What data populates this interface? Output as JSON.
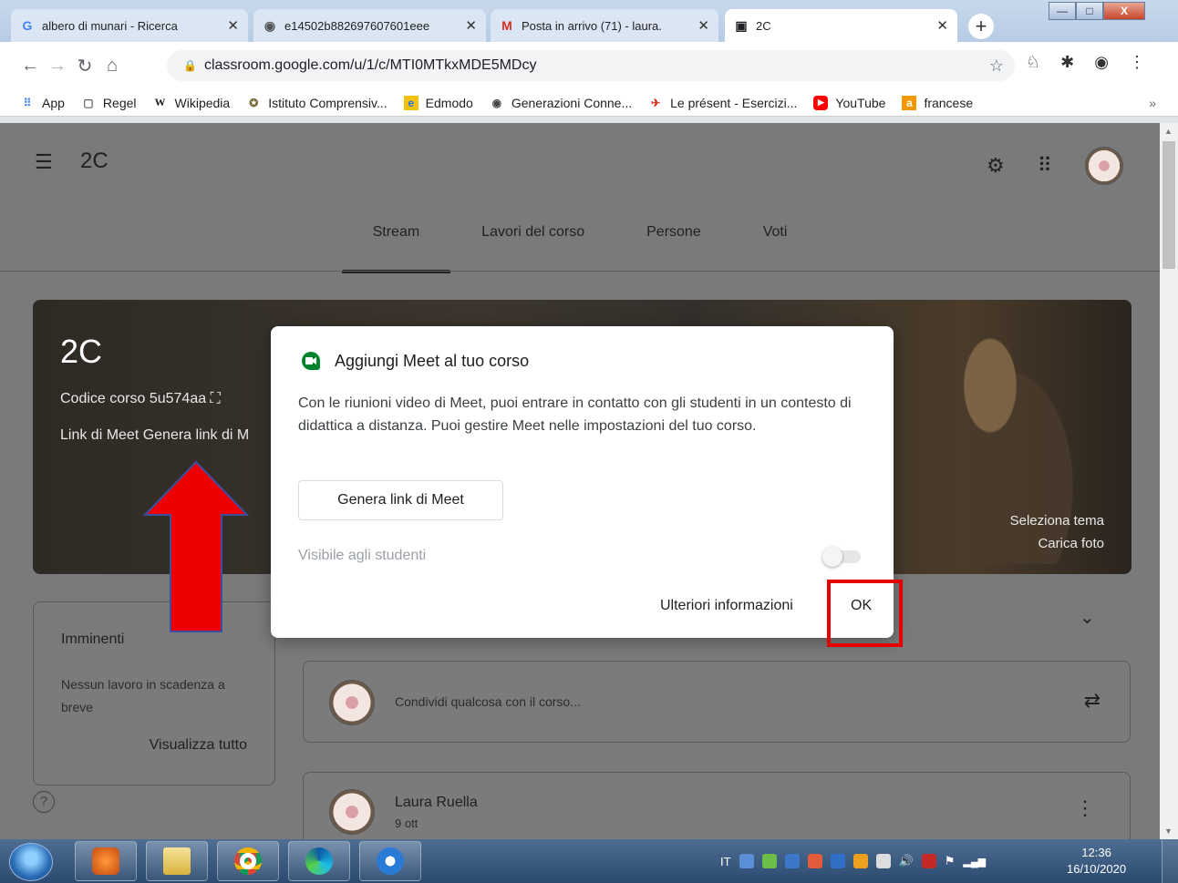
{
  "browser": {
    "tabs": [
      {
        "title": "albero di munari - Ricerca",
        "icon": "G",
        "color": "#4285f4"
      },
      {
        "title": "e14502b882697607601eee",
        "icon": "◉",
        "color": "#555555"
      },
      {
        "title": "Posta in arrivo (71) - laura.",
        "icon": "M",
        "color": "#d93025"
      },
      {
        "title": "2C",
        "icon": "▣",
        "color": "#202124"
      }
    ],
    "new_tab": "+",
    "window_controls": {
      "minimize": "—",
      "maximize": "□",
      "close": "X"
    },
    "address": "classroom.google.com/u/1/c/MTI0MTkxMDE5MDcy",
    "bookmarks": [
      {
        "label": "App",
        "icon": "grid-icon"
      },
      {
        "label": "Regel",
        "icon": "page-icon"
      },
      {
        "label": "Wikipedia",
        "icon": "W"
      },
      {
        "label": "Istituto Comprensiv...",
        "icon": "emblem-icon"
      },
      {
        "label": "Edmodo",
        "icon": "e"
      },
      {
        "label": "Generazioni Conne...",
        "icon": "globe-icon"
      },
      {
        "label": "Le présent - Esercizi...",
        "icon": "plane-icon"
      },
      {
        "label": "YouTube",
        "icon": "youtube-icon"
      },
      {
        "label": "francese",
        "icon": "a"
      }
    ],
    "bookmarks_more": "»"
  },
  "classroom": {
    "header_title": "2C",
    "tabs": [
      "Stream",
      "Lavori del corso",
      "Persone",
      "Voti"
    ],
    "active_tab": "Stream",
    "banner": {
      "title": "2C",
      "code_label": "Codice corso  5u574aa ⛶",
      "meet_label": "Link di Meet  Genera link di M",
      "select_theme": "Seleziona tema",
      "upload_photo": "Carica foto"
    },
    "upcoming": {
      "title": "Imminenti",
      "empty_text": "Nessun lavoro in scadenza a breve",
      "view_all": "Visualizza tutto"
    },
    "share_placeholder": "Condividi qualcosa con il corso...",
    "post": {
      "author": "Laura Ruella",
      "date": "9 ott"
    }
  },
  "dialog": {
    "title": "Aggiungi Meet al tuo corso",
    "body": "Con le riunioni video di Meet, puoi entrare in contatto con gli studenti in un contesto di didattica a distanza. Puoi gestire Meet nelle impostazioni del tuo corso.",
    "generate_button": "Genera link di Meet",
    "visible_label": "Visibile agli studenti",
    "more_info": "Ulteriori informazioni",
    "ok": "OK"
  },
  "taskbar": {
    "language": "IT",
    "time": "12:36",
    "date": "16/10/2020"
  },
  "colors": {
    "highlight_red": "#e50000",
    "meet_green": "#00832d",
    "dim_overlay": "#7a7a7a"
  }
}
